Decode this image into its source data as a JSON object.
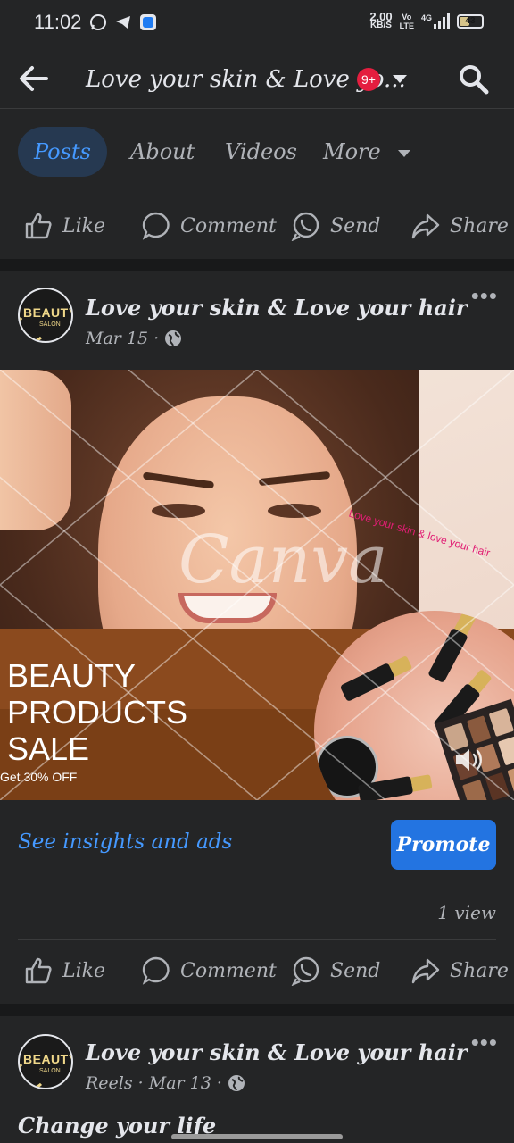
{
  "status_bar": {
    "time": "11:02",
    "speed_value": "2.00",
    "speed_unit": "KB/S",
    "volte_top": "Vo",
    "volte_bottom": "LTE",
    "network": "4G",
    "battery": "43",
    "app_icons": [
      "whatsapp-icon",
      "telegram-icon",
      "blue-app-icon"
    ]
  },
  "header": {
    "title": "Love your skin & Love yo...",
    "notification_badge": "9+"
  },
  "tabs": [
    {
      "label": "Posts",
      "active": true
    },
    {
      "label": "About",
      "active": false
    },
    {
      "label": "Videos",
      "active": false
    },
    {
      "label": "More",
      "active": false
    }
  ],
  "actions": {
    "like": "Like",
    "comment": "Comment",
    "send": "Send",
    "share": "Share"
  },
  "posts": [
    {
      "author": "Love your skin & Love your hair",
      "meta": "Mar 15 ·",
      "image": {
        "headline_line1": "BEAUTY",
        "headline_line2": "PRODUCTS",
        "headline_line3": "SALE",
        "discount": "Get 30% OFF",
        "watermark": "Canva",
        "overlay_text": "Love your skin & love your hair"
      },
      "insights_link": "See insights and ads",
      "promote_label": "Promote",
      "views": "1 view"
    },
    {
      "author": "Love your skin & Love your hair",
      "meta": "Reels · Mar 13 ·",
      "caption": "Change your life"
    }
  ],
  "avatar_text": "BEAUTY",
  "avatar_subtext": "SALON",
  "colors": {
    "background": "#18191a",
    "surface": "#242526",
    "accent": "#4599ff",
    "promote": "#2374e1",
    "badge": "#e41e3f"
  }
}
